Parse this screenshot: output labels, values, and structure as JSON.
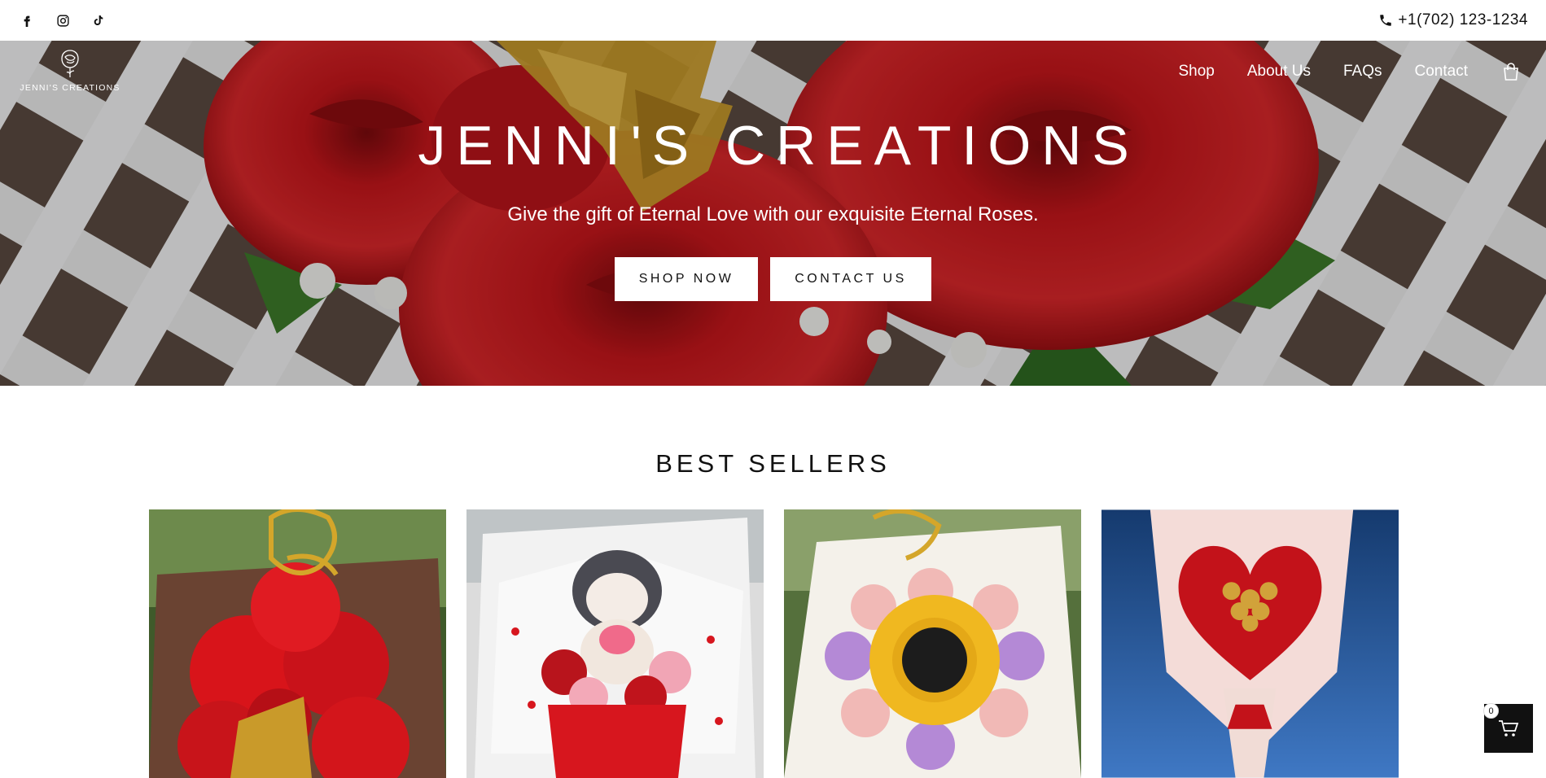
{
  "topbar": {
    "social_icons": [
      "facebook-icon",
      "instagram-icon",
      "tiktok-icon"
    ],
    "phone": "+1(702) 123-1234"
  },
  "header": {
    "logo_text": "JENNI'S CREATIONS",
    "nav": [
      {
        "label": "Shop"
      },
      {
        "label": "About Us"
      },
      {
        "label": "FAQs"
      },
      {
        "label": "Contact"
      }
    ],
    "cart_icon": "shopping-bag-icon"
  },
  "hero": {
    "title": "JENNI'S CREATIONS",
    "subtitle": "Give the gift of Eternal Love with our exquisite Eternal Roses.",
    "shop_button": "SHOP NOW",
    "contact_button": "CONTACT US"
  },
  "best_sellers": {
    "title": "BEST SELLERS",
    "products": [
      {
        "image": "red-roses-mothers-day-bouquet"
      },
      {
        "image": "kuromi-plush-rose-bouquet"
      },
      {
        "image": "sunflower-mothers-day-bouquet"
      },
      {
        "image": "red-heart-ferrero-bouquet"
      }
    ]
  },
  "cart": {
    "count": "0"
  },
  "colors": {
    "rose_red": "#c8141a",
    "gold": "#d4a62a",
    "button_bg": "#ffffff",
    "cart_bg": "#111111"
  }
}
